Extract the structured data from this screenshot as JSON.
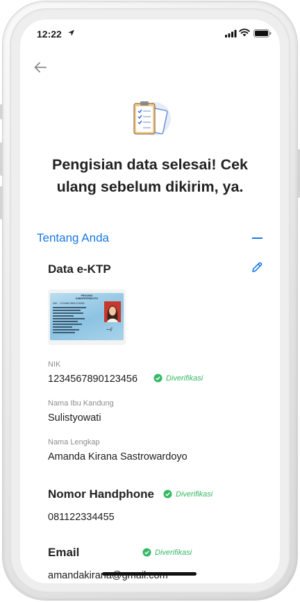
{
  "status_bar": {
    "time": "12:22"
  },
  "headline": "Pengisian data selesai! Cek ulang sebelum dikirim, ya.",
  "section": {
    "title": "Tentang Anda"
  },
  "ktp_card": {
    "title": "Data e-KTP",
    "image": {
      "province": "PROVINSI",
      "regency": "KABUPATEN/KOTA",
      "nik": "NIK : 1234567890123456"
    },
    "nik_label": "NIK",
    "nik_value": "1234567890123456",
    "nik_status": "Diverifikasi",
    "mother_label": "Nama Ibu Kandung",
    "mother_value": "Sulistyowati",
    "fullname_label": "Nama Lengkap",
    "fullname_value": "Amanda Kirana Sastrowardoyo"
  },
  "phone": {
    "title": "Nomor Handphone",
    "status": "Diverifikasi",
    "value": "081122334455"
  },
  "email": {
    "title": "Email",
    "status": "Diverifikasi",
    "value": "amandakirana@gmail.com"
  },
  "colors": {
    "accent": "#1677e6",
    "verified": "#36b865"
  }
}
